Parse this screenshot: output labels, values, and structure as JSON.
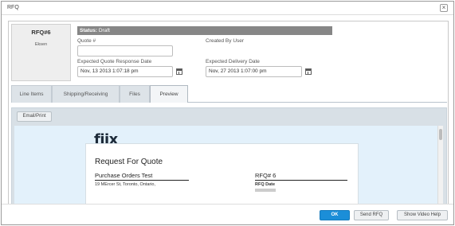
{
  "dialog": {
    "title": "RFQ",
    "close_glyph": "×"
  },
  "rfq": {
    "number": "RFQ#6",
    "owner": "Eksen"
  },
  "status": {
    "label": "Status:",
    "value": "Draft"
  },
  "fields": {
    "quote_number_label": "Quote #",
    "quote_number_value": "",
    "created_by_label": "Created By User",
    "expected_quote_response_label": "Expected Quote Response Date",
    "expected_quote_response_value": "Nov, 13 2013 1:07:18 pm",
    "expected_delivery_label": "Expected Delivery Date",
    "expected_delivery_value": "Nov, 27 2013 1:07:00 pm"
  },
  "tabs": [
    {
      "label": "Line Items"
    },
    {
      "label": "Shipping/Receiving"
    },
    {
      "label": "Files"
    },
    {
      "label": "Preview",
      "active": true
    }
  ],
  "preview": {
    "email_print_label": "Email/Print",
    "logo_text": "fiix",
    "doc_title": "Request For Quote",
    "vendor_name": "Purchase Orders Test",
    "vendor_address": "19 MErcer St, Toronto, Ontario,",
    "rfq_heading": "RFQ# 6",
    "rfq_date_label": "RFQ Date"
  },
  "footer": {
    "ok_label": "OK",
    "send_rfq_label": "Send RFQ",
    "video_help_label": "Show Video Help"
  },
  "colors": {
    "primary_button": "#1b8ed8",
    "status_bar": "#868686",
    "preview_background": "#e3f1fb"
  },
  "icons": [
    "close-icon",
    "calendar-icon"
  ]
}
